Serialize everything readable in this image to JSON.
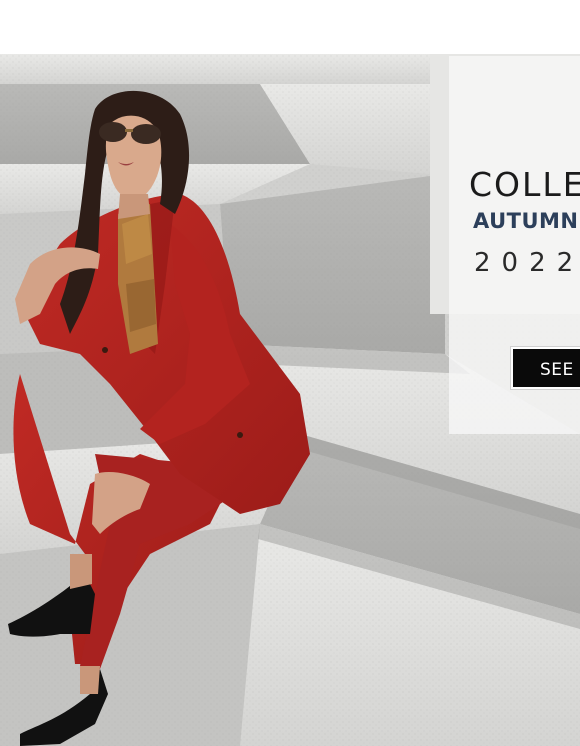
{
  "hero": {
    "collection_title": "COLLE",
    "season": "AUTUMN",
    "year": "2022",
    "cta_label": "SEE"
  },
  "colors": {
    "suit": "#b3231f",
    "stone": "#d9d9d7",
    "title_text": "#1b1b1b",
    "season_text": "#2c3f5a",
    "button_bg": "#0a0a0a"
  },
  "icons": []
}
